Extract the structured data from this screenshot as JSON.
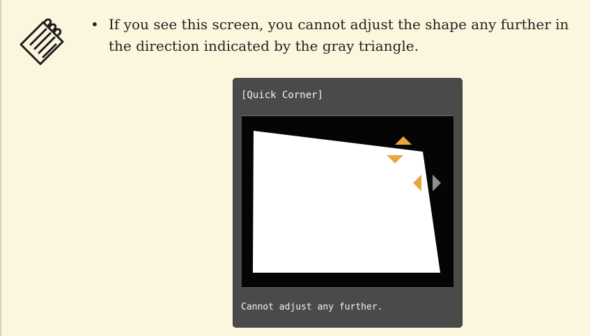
{
  "note": {
    "icon": "note-pencil-icon",
    "bullet": "•",
    "text": "If you see this screen, you cannot adjust the shape any further in the direction indicated by the gray triangle."
  },
  "osd": {
    "title": "[Quick Corner]",
    "status": "Cannot adjust any further.",
    "colors": {
      "active_arrow": "#e6a73c",
      "limit_arrow": "#8f8f8f",
      "screen": "#050505",
      "shape": "#ffffff",
      "panel": "#4a4a4a"
    }
  }
}
